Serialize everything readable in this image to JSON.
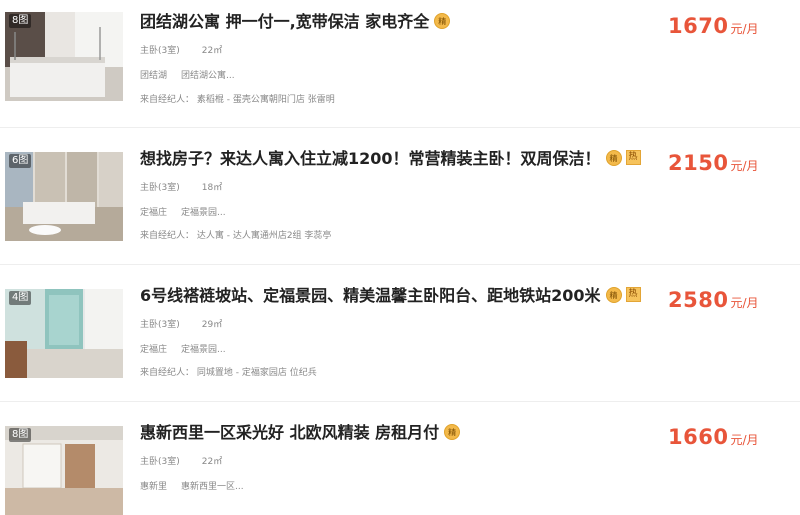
{
  "listings": [
    {
      "photo_count": "8图",
      "title": "团结湖公寓 押一付一,宽带保洁 家电齐全",
      "badge": "精",
      "hot": "",
      "room": "主卧(3室)",
      "area": "22㎡",
      "district": "团结湖",
      "community": "团结湖公寓...",
      "source": "来自经纪人：  素稻棍 - 蛋壳公寓朝阳门店 张雷明",
      "price": "1670",
      "unit": "元/月"
    },
    {
      "photo_count": "6图",
      "title": "想找房子？来达人寓入住立减1200！常营精装主卧！双周保洁！",
      "badge": "精",
      "hot": "热",
      "room": "主卧(3室)",
      "area": "18㎡",
      "district": "定福庄",
      "community": "定福景园...",
      "source": "来自经纪人：  达人寓 - 达人寓通州店2组 李蕊亭",
      "price": "2150",
      "unit": "元/月"
    },
    {
      "photo_count": "4图",
      "title": "6号线褡裢坡站、定福景园、精美温馨主卧阳台、距地铁站200米",
      "badge": "精",
      "hot": "热",
      "room": "主卧(3室)",
      "area": "29㎡",
      "district": "定福庄",
      "community": "定福景园...",
      "source": "来自经纪人：  同城置地 - 定福家园店 位纪兵",
      "price": "2580",
      "unit": "元/月"
    },
    {
      "photo_count": "8图",
      "title": "惠新西里一区采光好 北欧风精装 房租月付",
      "badge": "精",
      "hot": "",
      "room": "主卧(3室)",
      "area": "22㎡",
      "district": "惠新里",
      "community": "惠新西里一区...",
      "source": "",
      "price": "1660",
      "unit": "元/月"
    }
  ],
  "colors": {
    "price": "#e8553a",
    "badge": "#f3b94a"
  }
}
